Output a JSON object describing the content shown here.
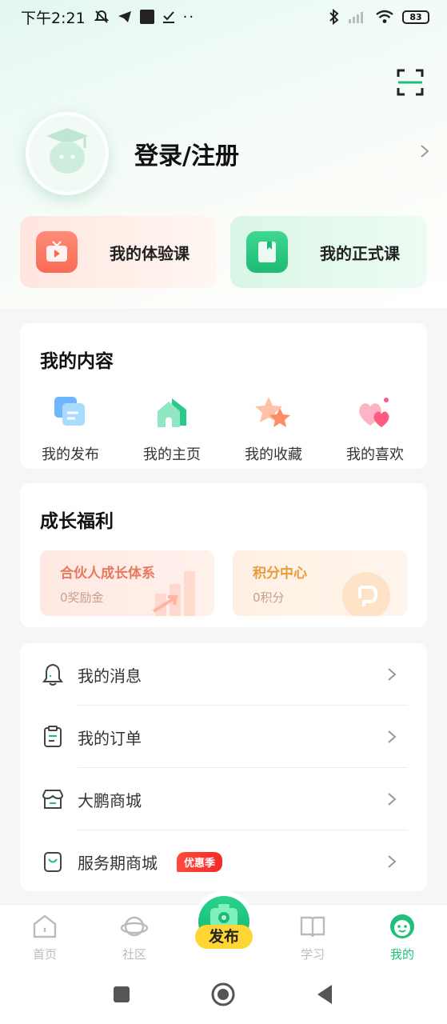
{
  "status_bar": {
    "time": "下午2:21",
    "battery": "83"
  },
  "profile": {
    "login_label": "登录/注册"
  },
  "courses": {
    "trial": "我的体验课",
    "formal": "我的正式课"
  },
  "my_content": {
    "title": "我的内容",
    "items": [
      {
        "label": "我的发布",
        "icon": "publish-doc-icon"
      },
      {
        "label": "我的主页",
        "icon": "home-icon"
      },
      {
        "label": "我的收藏",
        "icon": "star-icon"
      },
      {
        "label": "我的喜欢",
        "icon": "heart-icon"
      }
    ]
  },
  "benefits": {
    "title": "成长福利",
    "partner": {
      "title": "合伙人成长体系",
      "sub": "0奖励金"
    },
    "points": {
      "title": "积分中心",
      "sub": "0积分"
    }
  },
  "menu": {
    "items": [
      {
        "label": "我的消息",
        "icon": "bell-icon"
      },
      {
        "label": "我的订单",
        "icon": "order-icon"
      },
      {
        "label": "大鹏商城",
        "icon": "store-icon"
      },
      {
        "label": "服务期商城",
        "icon": "bag-icon"
      }
    ],
    "badge": "优惠季"
  },
  "tabbar": {
    "home": "首页",
    "community": "社区",
    "publish": "发布",
    "study": "学习",
    "mine": "我的"
  },
  "colors": {
    "accent": "#1fbf7a",
    "partner_title": "#e8795f",
    "points_title": "#e89a3c"
  }
}
